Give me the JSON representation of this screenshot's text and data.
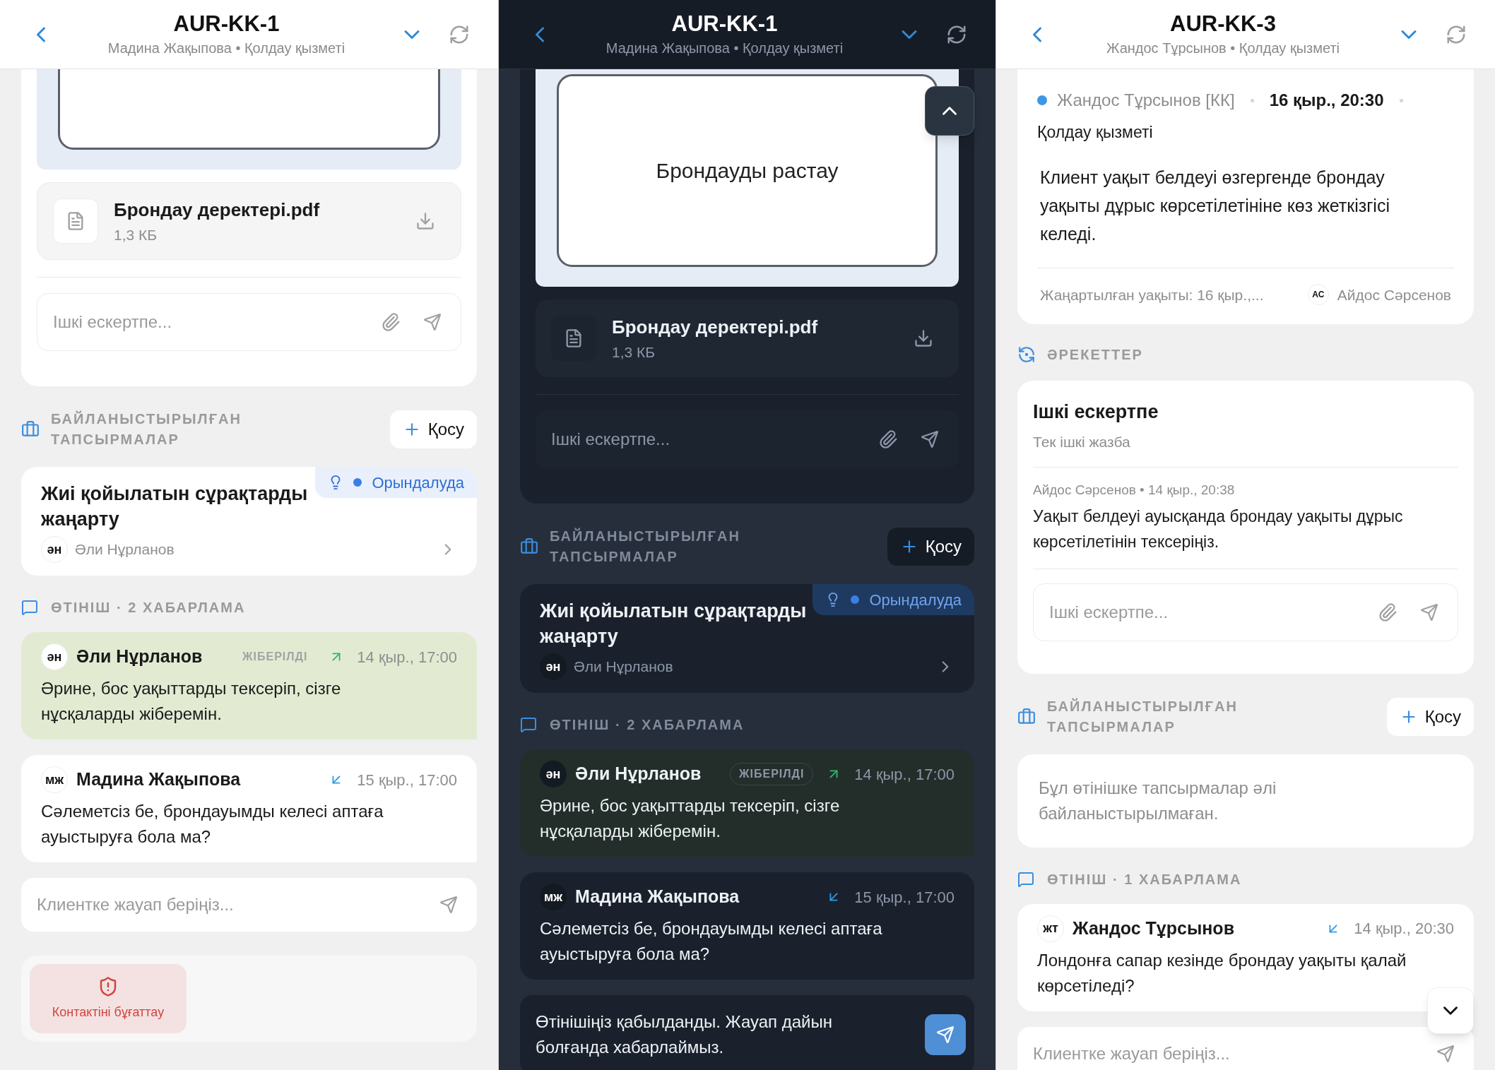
{
  "screens": [
    {
      "dark": false,
      "title": "AUR-KK-1",
      "subtitle": "Мадина Жақыпова • Қолдау қызметі",
      "sections": [
        {
          "kind": "note_card",
          "attachment": {
            "name": "Брондау деректері.pdf",
            "size": "1,3 КБ"
          },
          "note_placeholder": "Ішкі ескертпе..."
        },
        {
          "kind": "tasks",
          "title": "БАЙЛАНЫСТЫРЫЛҒАН ТАПСЫРМАЛАР",
          "add_label": "Қосу",
          "tasks": [
            {
              "title": "Жиі қойылатын сұрақтарды жаңарту",
              "status": "Орындалуда",
              "initials": "ән",
              "assignee": "Әли Нұрланов"
            }
          ]
        },
        {
          "kind": "messages",
          "title": "ӨТІНІШ · 2 ХАБАРЛАМА",
          "messages": [
            {
              "kind": "outgoing",
              "initials": "ән",
              "author": "Әли Нұрланов",
              "status_label": "ЖІБЕРІЛДІ",
              "time": "14 қыр., 17:00",
              "text": "Әрине, бос уақыттарды тексеріп, сізге нұсқаларды жіберемін."
            },
            {
              "kind": "incoming",
              "initials": "мж",
              "author": "Мадина Жақыпова",
              "time": "15 қыр., 17:00",
              "text": "Сәлеметсіз бе, брондауымды келесі аптаға ауыстыруға бола ма?"
            }
          ]
        },
        {
          "kind": "reply",
          "placeholder": "Клиентке жауап беріңіз...",
          "send_enabled": false
        },
        {
          "kind": "block_contact",
          "label": "Контактіні бұғаттау"
        }
      ]
    },
    {
      "dark": true,
      "title": "AUR-KK-1",
      "subtitle": "Мадина Жақыпова • Қолдау қызметі",
      "scroll_up_button": true,
      "sections": [
        {
          "kind": "note_card",
          "preview_caption": "Брондауды растау",
          "attachment": {
            "name": "Брондау деректері.pdf",
            "size": "1,3 КБ"
          },
          "note_placeholder": "Ішкі ескертпе..."
        },
        {
          "kind": "tasks",
          "title": "БАЙЛАНЫСТЫРЫЛҒАН ТАПСЫРМАЛАР",
          "add_label": "Қосу",
          "tasks": [
            {
              "title": "Жиі қойылатын сұрақтарды жаңарту",
              "status": "Орындалуда",
              "initials": "ән",
              "assignee": "Әли Нұрланов"
            }
          ]
        },
        {
          "kind": "messages",
          "title": "ӨТІНІШ · 2 ХАБАРЛАМА",
          "messages": [
            {
              "kind": "outgoing",
              "initials": "ән",
              "author": "Әли Нұрланов",
              "status_label": "ЖІБЕРІЛДІ",
              "time": "14 қыр., 17:00",
              "text": "Әрине, бос уақыттарды тексеріп, сізге нұсқаларды жіберемін."
            },
            {
              "kind": "incoming",
              "initials": "мж",
              "author": "Мадина Жақыпова",
              "time": "15 қыр., 17:00",
              "text": "Сәлеметсіз бе, брондауымды келесі аптаға ауыстыруға бола ма?"
            }
          ]
        },
        {
          "kind": "reply",
          "value": "Өтінішіңіз қабылданды. Жауап дайын болғанда хабарлаймыз.",
          "send_enabled": true
        }
      ]
    },
    {
      "dark": false,
      "title": "AUR-KK-3",
      "subtitle": "Жандос Тұрсынов • Қолдау қызметі",
      "scroll_down_button": true,
      "sections": [
        {
          "kind": "ticket_card",
          "author": "Жандос Тұрсынов [КК]",
          "time": "16 қыр., 20:30",
          "team": "Қолдау қызметі",
          "body": "Клиент уақыт белдеуі өзгергенде брондау уақыты дұрыс көрсетілетініне көз жеткізгісі келеді.",
          "updated": "Жаңартылған уақыты: 16 қыр.,...",
          "editor_initials": "АС",
          "editor": "Айдос Сәрсенов"
        },
        {
          "kind": "actions",
          "title": "ӘРЕКЕТТЕР",
          "items": [
            {
              "title": "Ішкі ескертпе",
              "subtitle": "Тек ішкі жазба",
              "meta": "Айдос Сәрсенов • 14 қыр., 20:38",
              "text": "Уақыт белдеуі ауысқанда брондау уақыты дұрыс көрсетілетінін тексеріңіз.",
              "note_placeholder": "Ішкі ескертпе..."
            }
          ]
        },
        {
          "kind": "tasks",
          "title": "БАЙЛАНЫСТЫРЫЛҒАН ТАПСЫРМАЛАР",
          "add_label": "Қосу",
          "empty_text": "Бұл өтінішке тапсырмалар әлі байланыстырылмаған."
        },
        {
          "kind": "messages",
          "title": "ӨТІНІШ · 1 ХАБАРЛАМА",
          "messages": [
            {
              "kind": "incoming",
              "initials": "жт",
              "author": "Жандос Тұрсынов",
              "time": "14 қыр., 20:30",
              "text": "Лондонға сапар кезінде брондау уақыты қалай көрсетіледі?"
            }
          ]
        },
        {
          "kind": "reply",
          "placeholder": "Клиентке жауап беріңіз...",
          "send_enabled": false
        }
      ]
    }
  ]
}
